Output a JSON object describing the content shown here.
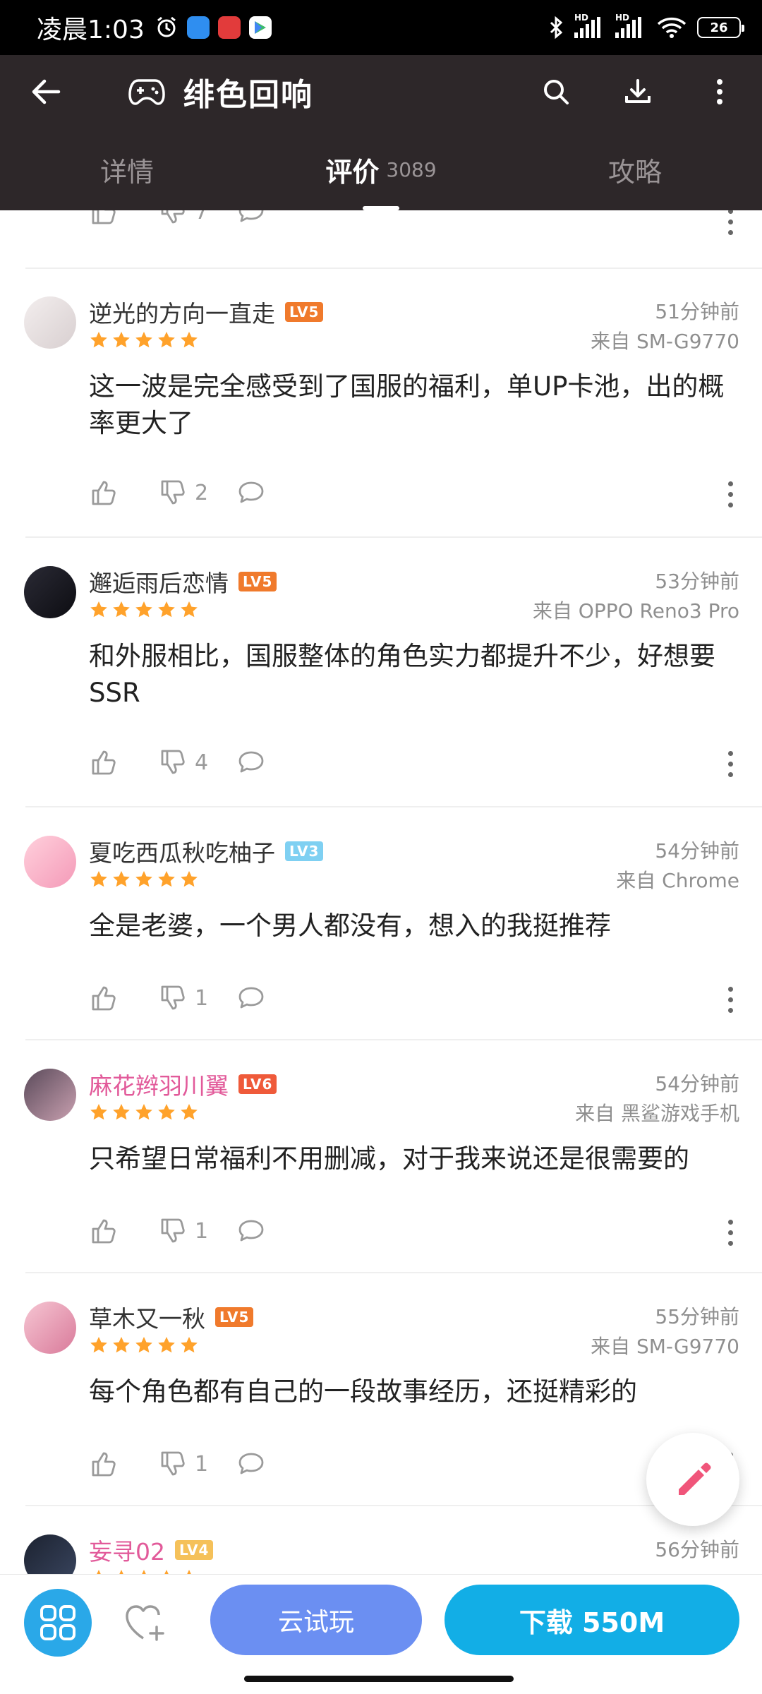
{
  "status_bar": {
    "time": "凌晨1:03",
    "battery": "26",
    "signal_labels": [
      "HD",
      "HD"
    ]
  },
  "header": {
    "title": "绯色回响",
    "back_icon": "arrow-left-icon",
    "game_icon": "gamepad-icon",
    "search_icon": "search-icon",
    "download_icon": "download-icon",
    "more_icon": "more-vertical-icon"
  },
  "tabs": [
    {
      "label": "详情",
      "count": ""
    },
    {
      "label": "评价",
      "count": "3089"
    },
    {
      "label": "攻略",
      "count": ""
    }
  ],
  "active_tab": 1,
  "partial_top": {
    "dislike_count": "7"
  },
  "reviews": [
    {
      "username": "逆光的方向一直走",
      "level": "LV5",
      "level_color": "#f07a2c",
      "rating": 5,
      "time": "51分钟前",
      "device": "来自 SM-G9770",
      "content": "这一波是完全感受到了国服的福利，单UP卡池，出的概率更大了",
      "dislike_count": "2"
    },
    {
      "username": "邂逅雨后恋情",
      "level": "LV5",
      "level_color": "#f07a2c",
      "rating": 5,
      "time": "53分钟前",
      "device": "来自 OPPO Reno3 Pro",
      "content": "和外服相比，国服整体的角色实力都提升不少，好想要SSR",
      "dislike_count": "4"
    },
    {
      "username": "夏吃西瓜秋吃柚子",
      "level": "LV3",
      "level_color": "#7fd0f2",
      "rating": 5,
      "time": "54分钟前",
      "device": "来自 Chrome",
      "content": "全是老婆，一个男人都没有，想入的我挺推荐",
      "dislike_count": "1"
    },
    {
      "username": "麻花辫羽川翼",
      "level": "LV6",
      "level_color": "#ef5a3a",
      "rating": 5,
      "time": "54分钟前",
      "device": "来自 黑鲨游戏手机",
      "content": "只希望日常福利不用删减，对于我来说还是很需要的",
      "dislike_count": "1"
    },
    {
      "username": "草木又一秋",
      "level": "LV5",
      "level_color": "#f07a2c",
      "rating": 5,
      "time": "55分钟前",
      "device": "来自 SM-G9770",
      "content": "每个角色都有自己的一段故事经历，还挺精彩的",
      "dislike_count": "1"
    },
    {
      "username": "妄寻02",
      "level": "LV4",
      "level_color": "#f5c15a",
      "rating": 5,
      "time": "56分钟前",
      "device": "",
      "content": "",
      "dislike_count": ""
    }
  ],
  "bottom_bar": {
    "trial_label": "云试玩",
    "download_label": "下载 550M",
    "grid_icon": "apps-grid-icon",
    "favorite_icon": "heart-add-icon",
    "fab_icon": "pencil-icon"
  },
  "colors": {
    "header_bg": "#2d2729",
    "star": "#ffa22b",
    "trial_button": "#6b8ff2",
    "download_button": "#12aee6",
    "grid_button": "#2aa8e8",
    "fab_pencil": "#f0557a"
  }
}
